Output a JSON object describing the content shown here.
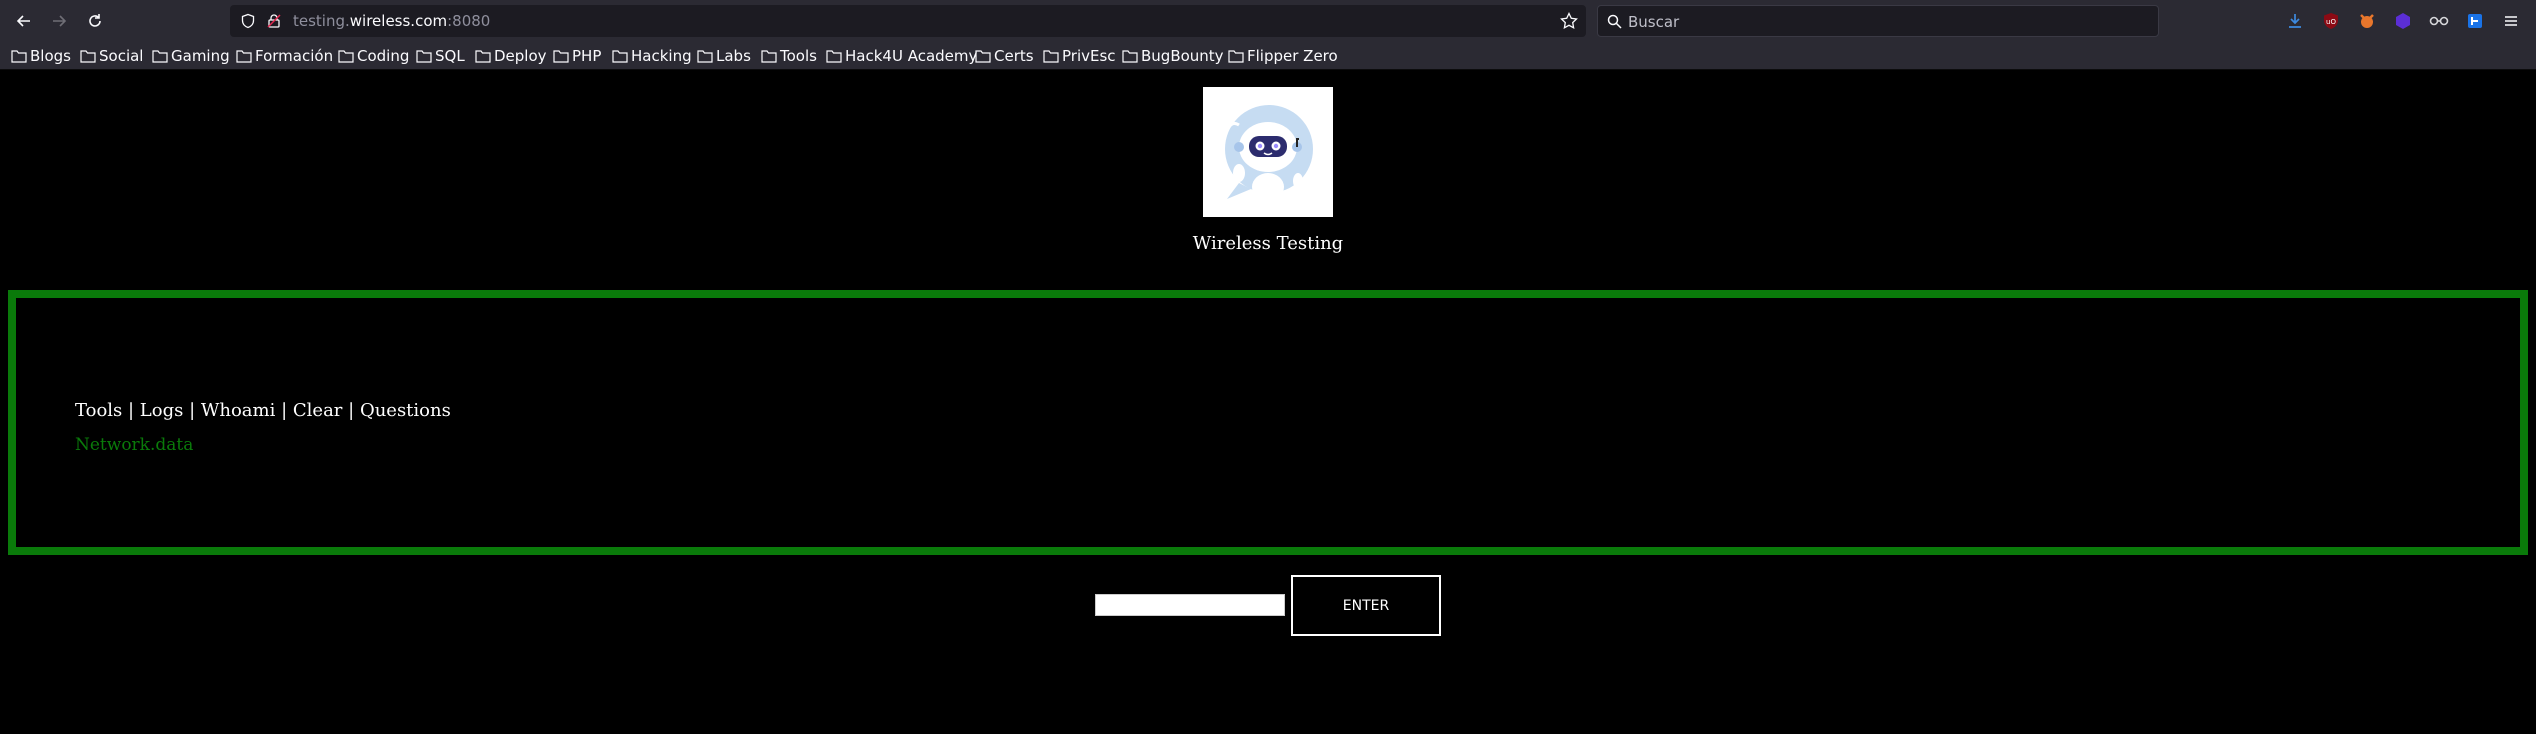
{
  "browser": {
    "url_prefix": "testing.",
    "url_host": "wireless.com",
    "url_suffix": ":8080",
    "search_placeholder": "Buscar",
    "bookmarks": [
      "Blogs",
      "Social",
      "Gaming",
      "Formación",
      "Coding",
      "SQL",
      "Deploy",
      "PHP",
      "Hacking",
      "Labs",
      "Tools",
      "Hack4U Academy",
      "Certs",
      "PrivEsc",
      "BugBounty",
      "Flipper Zero"
    ]
  },
  "page": {
    "title": "Wireless Testing",
    "menu": {
      "tools": "Tools",
      "logs": "Logs",
      "whoami": "Whoami",
      "clear": "Clear",
      "questions": "Questions",
      "separator": " | "
    },
    "output": "Network.data",
    "input_value": "",
    "enter_label": "ENTER"
  },
  "colors": {
    "terminal_border": "#0a7a0a",
    "output_text": "#0a7a0a",
    "background": "#000000"
  }
}
